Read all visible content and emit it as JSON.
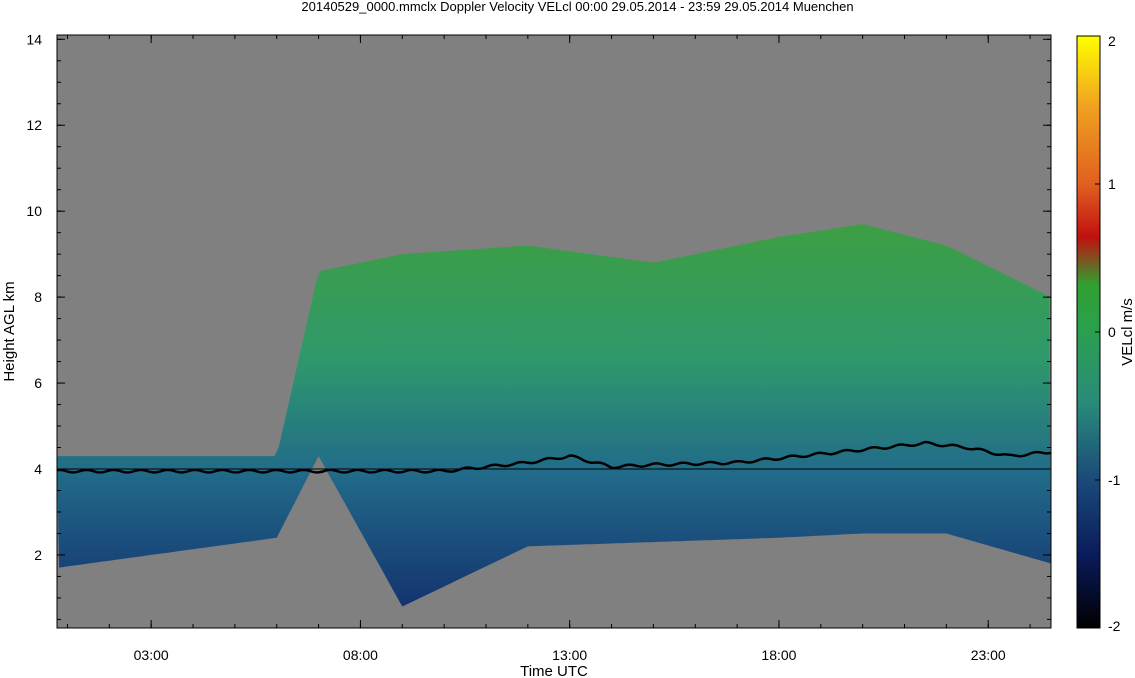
{
  "chart_data": {
    "type": "heatmap",
    "title": "20140529_0000.mmclx Doppler Velocity VELcl   00:00 29.05.2014 - 23:59 29.05.2014 Muenchen",
    "xlabel": "Time UTC",
    "ylabel": "Height AGL km",
    "colorbar_label": "VELcl m/s",
    "x_range_hours": [
      0.75,
      24.5
    ],
    "y_range_km": [
      0.3,
      14.1
    ],
    "x_ticks": [
      {
        "hour": 3,
        "label": "03:00"
      },
      {
        "hour": 8,
        "label": "08:00"
      },
      {
        "hour": 13,
        "label": "13:00"
      },
      {
        "hour": 18,
        "label": "18:00"
      },
      {
        "hour": 23,
        "label": "23:00"
      }
    ],
    "y_ticks": [
      {
        "km": 2,
        "label": "2"
      },
      {
        "km": 4,
        "label": "4"
      },
      {
        "km": 6,
        "label": "6"
      },
      {
        "km": 8,
        "label": "8"
      },
      {
        "km": 10,
        "label": "10"
      },
      {
        "km": 12,
        "label": "12"
      },
      {
        "km": 14,
        "label": "14"
      }
    ],
    "colorbar_range": [
      -2,
      2
    ],
    "colorbar_ticks": [
      {
        "value": 2,
        "label": "2"
      },
      {
        "value": 1,
        "label": "1"
      },
      {
        "value": 0,
        "label": "0"
      },
      {
        "value": -1,
        "label": "-1"
      },
      {
        "value": -2,
        "label": "-2"
      }
    ],
    "reference_line_km": 4,
    "background_color": "#808080",
    "colormap": [
      "#000000",
      "#0a1a5a",
      "#1a4a7a",
      "#2a8a7a",
      "#2aa050",
      "#30a030",
      "#c01010",
      "#e06020",
      "#f0a020",
      "#ffff00"
    ],
    "cloud_top_km": [
      {
        "hour": 0.75,
        "top": 4.3,
        "base": 1.7
      },
      {
        "hour": 6.0,
        "top": 4.3,
        "base": 2.4
      },
      {
        "hour": 7.0,
        "top": 8.6,
        "base": 4.3
      },
      {
        "hour": 9.0,
        "top": 9.0,
        "base": 0.8
      },
      {
        "hour": 12.0,
        "top": 9.2,
        "base": 2.2
      },
      {
        "hour": 15.0,
        "top": 8.8,
        "base": 2.3
      },
      {
        "hour": 18.0,
        "top": 9.4,
        "base": 2.4
      },
      {
        "hour": 20.0,
        "top": 9.7,
        "base": 2.5
      },
      {
        "hour": 22.0,
        "top": 9.2,
        "base": 2.5
      },
      {
        "hour": 24.5,
        "top": 8.0,
        "base": 1.8
      }
    ],
    "boundary_layer_top_km": [
      {
        "hour": 0.75,
        "km": 3.95
      },
      {
        "hour": 10.0,
        "km": 3.95
      },
      {
        "hour": 11.5,
        "km": 4.1
      },
      {
        "hour": 12.0,
        "km": 4.15
      },
      {
        "hour": 13.0,
        "km": 4.3
      },
      {
        "hour": 14.0,
        "km": 4.05
      },
      {
        "hour": 15.0,
        "km": 4.1
      },
      {
        "hour": 17.0,
        "km": 4.15
      },
      {
        "hour": 19.0,
        "km": 4.35
      },
      {
        "hour": 20.0,
        "km": 4.45
      },
      {
        "hour": 21.5,
        "km": 4.6
      },
      {
        "hour": 22.5,
        "km": 4.5
      },
      {
        "hour": 23.5,
        "km": 4.3
      },
      {
        "hour": 24.5,
        "km": 4.4
      }
    ]
  }
}
